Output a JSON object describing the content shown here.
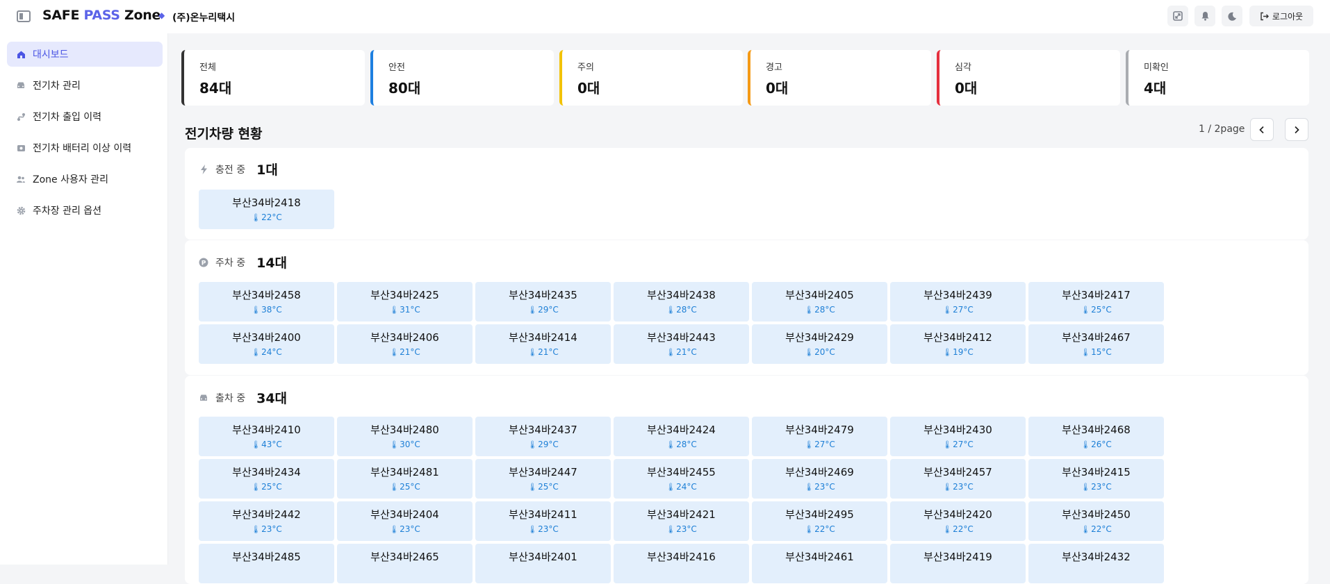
{
  "header": {
    "brand_safe": "SAFE",
    "brand_pass": "PASS",
    "brand_zone": "Zone",
    "separator": "◆",
    "company": "(주)온누리택시",
    "logout_label": "로그아웃"
  },
  "sidebar": {
    "items": [
      {
        "label": "대시보드",
        "icon": "home-icon",
        "active": true
      },
      {
        "label": "전기차 관리",
        "icon": "car-icon",
        "active": false
      },
      {
        "label": "전기차 출입 이력",
        "icon": "route-icon",
        "active": false
      },
      {
        "label": "전기차 배터리 이상 이력",
        "icon": "battery-alert-icon",
        "active": false
      },
      {
        "label": "Zone 사용자 관리",
        "icon": "users-icon",
        "active": false
      },
      {
        "label": "주차장 관리 옵션",
        "icon": "gear-icon",
        "active": false
      }
    ]
  },
  "stats": [
    {
      "label": "전체",
      "value": "84대",
      "color": "#333333"
    },
    {
      "label": "안전",
      "value": "80대",
      "color": "#1e7fe0"
    },
    {
      "label": "주의",
      "value": "0대",
      "color": "#f2c200"
    },
    {
      "label": "경고",
      "value": "0대",
      "color": "#f59a16"
    },
    {
      "label": "심각",
      "value": "0대",
      "color": "#e5303e"
    },
    {
      "label": "미확인",
      "value": "4대",
      "color": "#a9acb1"
    }
  ],
  "main": {
    "title": "전기차량 현황",
    "pager": "1 / 2page"
  },
  "groups": [
    {
      "label": "충전 중",
      "count": "1대",
      "icon": "lightning-icon",
      "cars": [
        {
          "plate": "부산34바2418",
          "temp": "22°C"
        }
      ]
    },
    {
      "label": "주차 중",
      "count": "14대",
      "icon": "parking-icon",
      "cars": [
        {
          "plate": "부산34바2458",
          "temp": "38°C"
        },
        {
          "plate": "부산34바2425",
          "temp": "31°C"
        },
        {
          "plate": "부산34바2435",
          "temp": "29°C"
        },
        {
          "plate": "부산34바2438",
          "temp": "28°C"
        },
        {
          "plate": "부산34바2405",
          "temp": "28°C"
        },
        {
          "plate": "부산34바2439",
          "temp": "27°C"
        },
        {
          "plate": "부산34바2417",
          "temp": "25°C"
        },
        {
          "plate": "부산34바2400",
          "temp": "24°C"
        },
        {
          "plate": "부산34바2406",
          "temp": "21°C"
        },
        {
          "plate": "부산34바2414",
          "temp": "21°C"
        },
        {
          "plate": "부산34바2443",
          "temp": "21°C"
        },
        {
          "plate": "부산34바2429",
          "temp": "20°C"
        },
        {
          "plate": "부산34바2412",
          "temp": "19°C"
        },
        {
          "plate": "부산34바2467",
          "temp": "15°C"
        }
      ]
    },
    {
      "label": "출차 중",
      "count": "34대",
      "icon": "car-icon",
      "cars": [
        {
          "plate": "부산34바2410",
          "temp": "43°C"
        },
        {
          "plate": "부산34바2480",
          "temp": "30°C"
        },
        {
          "plate": "부산34바2437",
          "temp": "29°C"
        },
        {
          "plate": "부산34바2424",
          "temp": "28°C"
        },
        {
          "plate": "부산34바2479",
          "temp": "27°C"
        },
        {
          "plate": "부산34바2430",
          "temp": "27°C"
        },
        {
          "plate": "부산34바2468",
          "temp": "26°C"
        },
        {
          "plate": "부산34바2434",
          "temp": "25°C"
        },
        {
          "plate": "부산34바2481",
          "temp": "25°C"
        },
        {
          "plate": "부산34바2447",
          "temp": "25°C"
        },
        {
          "plate": "부산34바2455",
          "temp": "24°C"
        },
        {
          "plate": "부산34바2469",
          "temp": "23°C"
        },
        {
          "plate": "부산34바2457",
          "temp": "23°C"
        },
        {
          "plate": "부산34바2415",
          "temp": "23°C"
        },
        {
          "plate": "부산34바2442",
          "temp": "23°C"
        },
        {
          "plate": "부산34바2404",
          "temp": "23°C"
        },
        {
          "plate": "부산34바2411",
          "temp": "23°C"
        },
        {
          "plate": "부산34바2421",
          "temp": "23°C"
        },
        {
          "plate": "부산34바2495",
          "temp": "22°C"
        },
        {
          "plate": "부산34바2420",
          "temp": "22°C"
        },
        {
          "plate": "부산34바2450",
          "temp": "22°C"
        },
        {
          "plate": "부산34바2485",
          "temp": ""
        },
        {
          "plate": "부산34바2465",
          "temp": ""
        },
        {
          "plate": "부산34바2401",
          "temp": ""
        },
        {
          "plate": "부산34바2416",
          "temp": ""
        },
        {
          "plate": "부산34바2461",
          "temp": ""
        },
        {
          "plate": "부산34바2419",
          "temp": ""
        },
        {
          "plate": "부산34바2432",
          "temp": ""
        }
      ]
    }
  ]
}
